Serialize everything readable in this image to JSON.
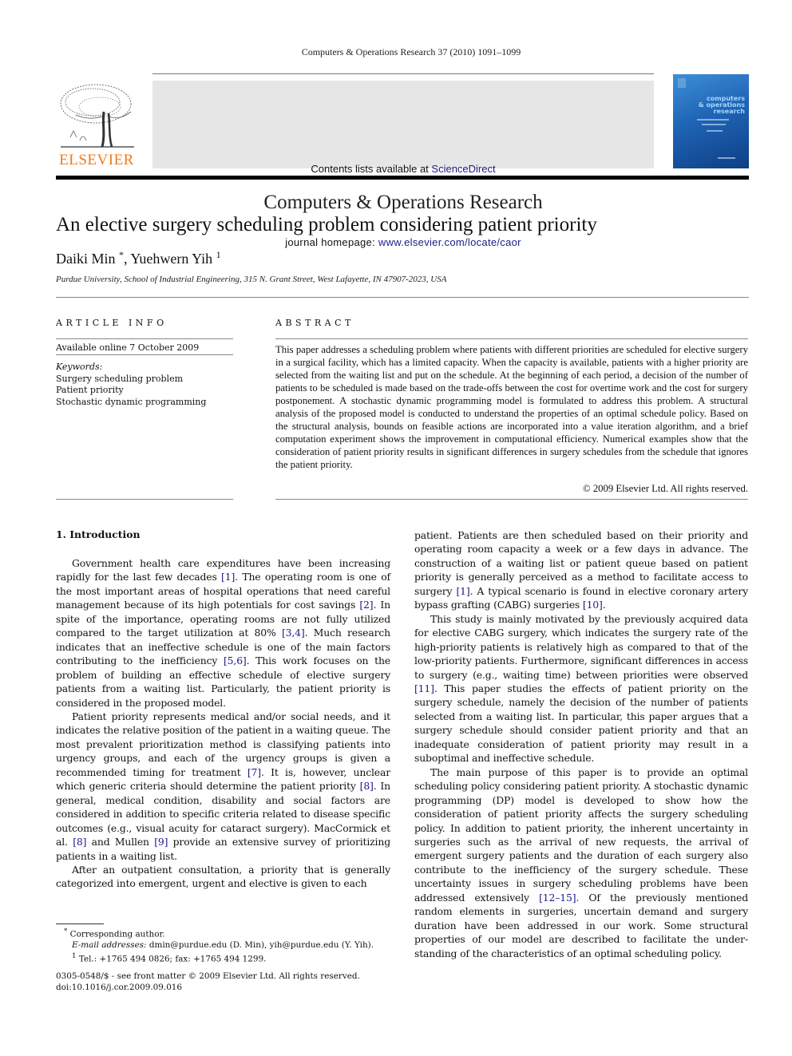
{
  "running_head": "Computers & Operations Research 37 (2010) 1091–1099",
  "banner": {
    "contents_prefix": "Contents lists available at ",
    "contents_link": "ScienceDirect",
    "journal_title": "Computers & Operations Research",
    "homepage_prefix": "journal homepage: ",
    "homepage_link": "www.elsevier.com/locate/caor"
  },
  "publisher_logo": {
    "wordmark": "ELSEVIER",
    "color": "#f07a1c",
    "icon": "tree-logo-icon"
  },
  "cover": {
    "title_lines": [
      "computers",
      "& operations",
      "research"
    ],
    "color": "#1f64b5"
  },
  "article": {
    "title": "An elective surgery scheduling problem considering patient priority",
    "authors": [
      {
        "name": "Daiki Min",
        "mark": "*"
      },
      {
        "name": "Yuehwern Yih",
        "mark": "1"
      }
    ],
    "author_separator": ", ",
    "affiliation": "Purdue University, School of Industrial Engineering, 315 N. Grant Street, West Lafayette, IN 47907-2023, USA"
  },
  "article_info": {
    "heading": "ARTICLE INFO",
    "available_online": "Available online 7 October 2009",
    "keywords_label": "Keywords:",
    "keywords": [
      "Surgery scheduling problem",
      "Patient priority",
      "Stochastic dynamic programming"
    ]
  },
  "abstract": {
    "heading": "ABSTRACT",
    "text": "This paper addresses a scheduling problem where patients with different priorities are scheduled for elective surgery in a surgical facility, which has a limited capacity. When the capacity is available, patients with a higher priority are selected from the waiting list and put on the schedule. At the beginning of each period, a decision of the number of patients to be scheduled is made based on the trade-offs between the cost for overtime work and the cost for surgery postponement. A stochastic dynamic programming model is formulated to address this problem. A structural analysis of the proposed model is conducted to understand the properties of an optimal schedule policy. Based on the structural analysis, bounds on feasible actions are incorporated into a value iteration algorithm, and a brief computation experiment shows the improvement in computational efficiency. Numerical examples show that the consideration of patient priority results in significant differences in surgery schedules from the schedule that ignores the patient priority.",
    "copyright": "© 2009 Elsevier Ltd. All rights reserved."
  },
  "body": {
    "section_heading": "1.  Introduction",
    "left_column": [
      {
        "indent": true,
        "segments": [
          {
            "t": "Government health care expenditures have been increasing rapidly for the last few decades "
          },
          {
            "ref": "[1]"
          },
          {
            "t": ". The operating room is one of the most important areas of hospital operations that need careful management because of its high potentials for cost savings "
          },
          {
            "ref": "[2]"
          },
          {
            "t": ". In spite of the importance, operating rooms are not fully utilized compared to the target utilization at 80% "
          },
          {
            "ref": "[3,4]"
          },
          {
            "t": ". Much research indicates that an ineffective schedule is one of the main factors contributing to the inefficiency "
          },
          {
            "ref": "[5,6]"
          },
          {
            "t": ". This work focuses on the problem of building an effective schedule of elective surgery patients from a waiting list. Particularly, the patient priority is considered in the proposed model."
          }
        ]
      },
      {
        "indent": true,
        "segments": [
          {
            "t": "Patient priority represents medical and/or social needs, and it indicates the relative position of the patient in a waiting queue. The most prevalent prioritization method is classifying patients into urgency groups, and each of the urgency groups is given a recommended timing for treatment "
          },
          {
            "ref": "[7]"
          },
          {
            "t": ". It is, however, unclear which generic criteria should determine the patient priority "
          },
          {
            "ref": "[8]"
          },
          {
            "t": ". In general, medical condition, disability and social factors are considered in addition to specific criteria related to disease specific outcomes (e.g., visual acuity for cataract surgery). MacCormick et al. "
          },
          {
            "ref": "[8]"
          },
          {
            "t": " and Mullen "
          },
          {
            "ref": "[9]"
          },
          {
            "t": " provide an extensive survey of prioritizing patients in a waiting list."
          }
        ]
      },
      {
        "indent": true,
        "segments": [
          {
            "t": "After an outpatient consultation, a priority that is generally categorized into emergent, urgent and elective is given to each"
          }
        ]
      }
    ],
    "right_column": [
      {
        "indent": false,
        "segments": [
          {
            "t": "patient. Patients are then scheduled based on their priority and operating room capacity a week or a few days in advance. The construction of a waiting list or patient queue based on patient priority is generally perceived as a method to facilitate access to surgery "
          },
          {
            "ref": "[1]"
          },
          {
            "t": ". A typical scenario is found in elective coronary artery bypass grafting (CABG) surgeries "
          },
          {
            "ref": "[10]"
          },
          {
            "t": "."
          }
        ]
      },
      {
        "indent": true,
        "segments": [
          {
            "t": "This study is mainly motivated by the previously acquired data for elective CABG surgery, which indicates the surgery rate of the high-priority patients is relatively high as compared to that of the low-priority patients. Furthermore, significant differences in access to surgery (e.g., waiting time) between priorities were observed "
          },
          {
            "ref": "[11]"
          },
          {
            "t": ". This paper studies the effects of patient priority on the surgery schedule, namely the decision of the number of patients selected from a waiting list. In particular, this paper argues that a surgery schedule should consider patient priority and that an inadequate consideration of patient priority may result in a suboptimal and ineffective schedule."
          }
        ]
      },
      {
        "indent": true,
        "segments": [
          {
            "t": "The main purpose of this paper is to provide an optimal scheduling policy considering patient priority. A stochastic dynamic programming (DP) model is developed to show how the consideration of patient priority affects the surgery scheduling policy. In addition to patient priority, the inherent uncertainty in surgeries such as the arrival of new requests, the arrival of emergent surgery patients and the duration of each surgery also contribute to the inefficiency of the surgery schedule. These uncertainty issues in surgery scheduling problems have been addressed extensively "
          },
          {
            "ref": "[12–15]"
          },
          {
            "t": ". Of the previously mentioned random elements in surgeries, uncertain demand and surgery duration have been addressed in our work. Some structural properties of our model are described to facilitate the under-standing of the characteristics of an optimal scheduling policy."
          }
        ]
      }
    ]
  },
  "footnotes": {
    "corresponding_mark": "*",
    "corresponding": "Corresponding author.",
    "email_label": "E-mail addresses:",
    "emails": "dmin@purdue.edu (D. Min), yih@purdue.edu (Y. Yih).",
    "tel_mark": "1",
    "tel": "Tel.: +1765 494 0826; fax: +1765 494 1299."
  },
  "front_matter": {
    "issn_line": "0305-0548/$ - see front matter © 2009 Elsevier Ltd. All rights reserved.",
    "doi": "doi:10.1016/j.cor.2009.09.016"
  }
}
